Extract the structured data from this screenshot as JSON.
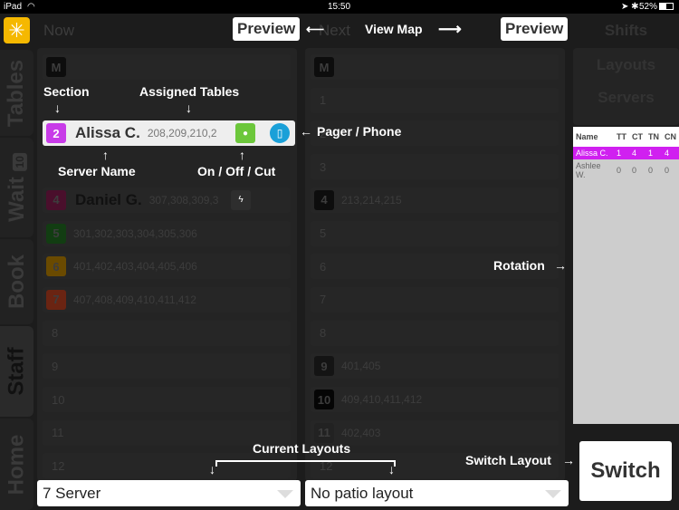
{
  "status_bar": {
    "device": "iPad",
    "time": "15:50",
    "battery": "52%"
  },
  "sidebar": {
    "tabs": [
      {
        "label": "Tables"
      },
      {
        "label": "Wait",
        "badge": "10"
      },
      {
        "label": "Book"
      },
      {
        "label": "Staff",
        "active": true
      },
      {
        "label": "Home"
      }
    ]
  },
  "now_column": {
    "title": "Now",
    "rows": [
      {
        "section": "M",
        "color": "#0d0d0d"
      },
      {
        "section": "2",
        "color": "#c83be8",
        "name": "Alissa C.",
        "tables": "208,209,210,2",
        "status": "on",
        "pager": true,
        "highlight": true
      },
      {
        "section": "4",
        "color": "#4a0f2c",
        "name": "Daniel G.",
        "tables": "307,308,309,3",
        "status": "cut",
        "pager": false
      },
      {
        "section": "5",
        "color": "#123d12",
        "tables": "301,302,303,304,305,306"
      },
      {
        "section": "6",
        "color": "#6a4a00",
        "tables": "401,402,403,404,405,406"
      },
      {
        "section": "7",
        "color": "#6a2412",
        "tables": "407,408,409,410,411,412"
      },
      {
        "section": "8"
      },
      {
        "section": "9"
      },
      {
        "section": "10"
      },
      {
        "section": "11"
      },
      {
        "section": "12"
      }
    ]
  },
  "next_column": {
    "title": "Next",
    "rows": [
      {
        "section": "M",
        "color": "#0d0d0d"
      },
      {
        "section": "1"
      },
      {
        "section": "2"
      },
      {
        "section": "3"
      },
      {
        "section": "4",
        "color": "#0d0d0d",
        "tables": "213,214,215"
      },
      {
        "section": "5"
      },
      {
        "section": "6"
      },
      {
        "section": "7"
      },
      {
        "section": "8"
      },
      {
        "section": "9",
        "color": "#141414",
        "tables": "401,405"
      },
      {
        "section": "10",
        "color": "#050505",
        "tables": "409,410,411,412"
      },
      {
        "section": "11",
        "color": "#222",
        "tables": "402,403"
      },
      {
        "section": "12"
      }
    ]
  },
  "right_panel": {
    "title": "Shifts",
    "layouts": "Layouts",
    "servers": "Servers",
    "switch": "Switch",
    "rotation": {
      "columns": [
        "Name",
        "TT",
        "CT",
        "TN",
        "CN"
      ],
      "rows": [
        [
          "Alissa C.",
          "1",
          "4",
          "1",
          "4"
        ],
        [
          "Ashlee W.",
          "0",
          "0",
          "0",
          "0"
        ]
      ]
    }
  },
  "layout_selects": {
    "now": "7 Server",
    "next": "No patio layout"
  },
  "annotations": {
    "preview": "Preview",
    "view_map": "View Map",
    "section": "Section",
    "assigned_tables": "Assigned Tables",
    "server_name": "Server Name",
    "on_off_cut": "On / Off / Cut",
    "pager_phone": "Pager / Phone",
    "rotation": "Rotation",
    "current_layouts": "Current Layouts",
    "switch_layout": "Switch Layout"
  },
  "colors": {
    "accent": "#f5b800",
    "highlight": "#d020f0",
    "on": "#6cc73b",
    "pager": "#1aa0d8"
  }
}
